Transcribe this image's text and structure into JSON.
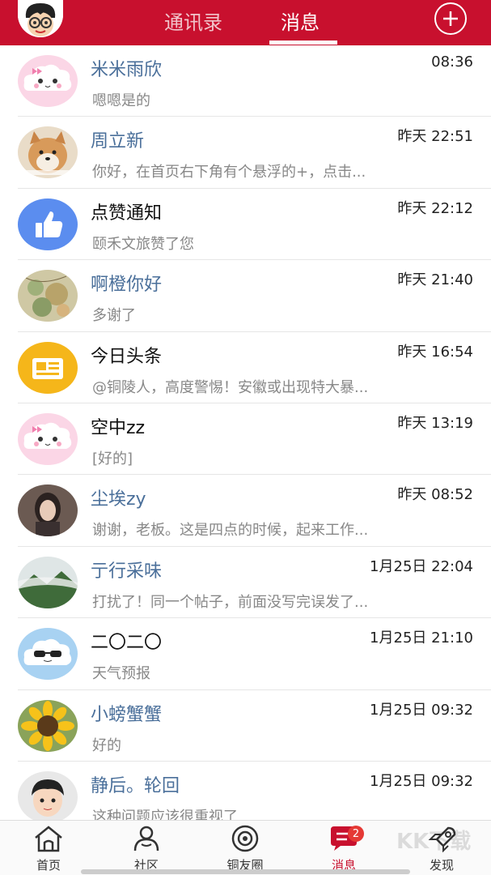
{
  "header": {
    "tabs": [
      {
        "label": "通讯录",
        "active": false
      },
      {
        "label": "消息",
        "active": true
      }
    ],
    "add_icon": "plus-circle-icon",
    "avatar": "cartoon-face-glasses"
  },
  "colors": {
    "brand": "#c8102e",
    "name_link": "#4a6f9a",
    "preview_text": "#888888",
    "badge": "#e53935"
  },
  "messages": [
    {
      "name": "米米雨欣",
      "linked": true,
      "time": "08:36",
      "preview": "嗯嗯是的",
      "avatar": "pink-cloud"
    },
    {
      "name": "周立新",
      "linked": true,
      "time": "昨天 22:51",
      "preview": "你好，在首页右下角有个悬浮的+，点击...",
      "avatar": "shiba-dog"
    },
    {
      "name": "点赞通知",
      "linked": false,
      "time": "昨天 22:12",
      "preview": "颐禾文旅赞了您",
      "avatar": "thumbs-up"
    },
    {
      "name": "啊橙你好",
      "linked": true,
      "time": "昨天 21:40",
      "preview": "多谢了",
      "avatar": "painting"
    },
    {
      "name": "今日头条",
      "linked": false,
      "time": "昨天 16:54",
      "preview": "@铜陵人，高度警惕！安徽或出现特大暴...",
      "avatar": "newspaper"
    },
    {
      "name": "空中zz",
      "linked": false,
      "time": "昨天 13:19",
      "preview": "[好的]",
      "avatar": "pink-cloud"
    },
    {
      "name": "尘埃zy",
      "linked": true,
      "time": "昨天 08:52",
      "preview": "谢谢，老板。这是四点的时候，起来工作...",
      "avatar": "woman-photo"
    },
    {
      "name": "亍行采味",
      "linked": true,
      "time": "1月25日 22:04",
      "preview": "打扰了！同一个帖子，前面没写完误发了...",
      "avatar": "mountain-fog"
    },
    {
      "name": "二〇二〇",
      "linked": false,
      "time": "1月25日 21:10",
      "preview": "天气预报",
      "avatar": "sunglasses-cloud"
    },
    {
      "name": "小螃蟹蟹",
      "linked": true,
      "time": "1月25日 09:32",
      "preview": "好的",
      "avatar": "sunflower"
    },
    {
      "name": "静后。轮回",
      "linked": true,
      "time": "1月25日 09:32",
      "preview": "这种问题应该很重视了",
      "avatar": "cartoon-boy"
    }
  ],
  "bottom_nav": [
    {
      "label": "首页",
      "icon": "home-icon",
      "active": false
    },
    {
      "label": "社区",
      "icon": "community-icon",
      "active": false
    },
    {
      "label": "铜友圈",
      "icon": "circle-icon",
      "active": false
    },
    {
      "label": "消息",
      "icon": "message-icon",
      "active": true,
      "badge": "2"
    },
    {
      "label": "发现",
      "icon": "rocket-icon",
      "active": false
    }
  ],
  "watermark": "KK下载"
}
